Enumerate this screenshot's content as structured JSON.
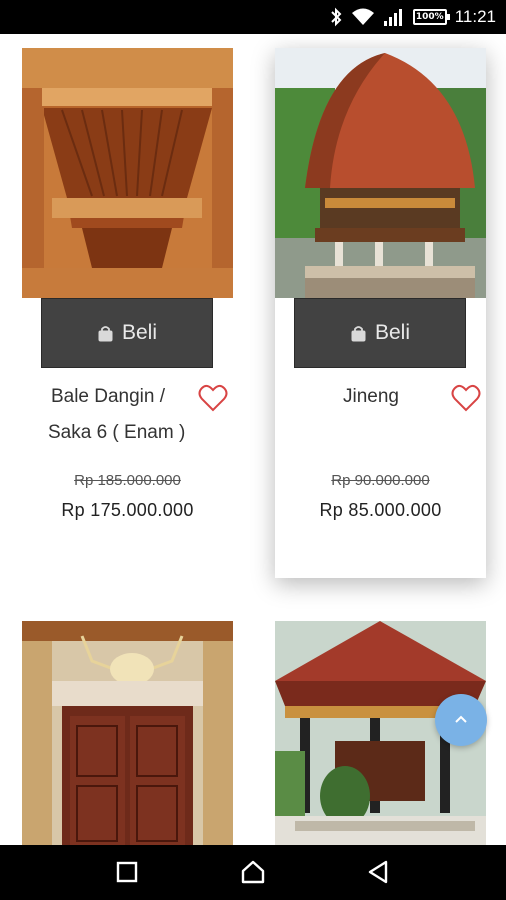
{
  "status_bar": {
    "battery": "100%",
    "time": "11:21",
    "icons": [
      "bluetooth-icon",
      "wifi-icon",
      "signal-icon",
      "battery-icon"
    ]
  },
  "products": [
    {
      "title_line1": "Bale Dangin /",
      "title_line2": "Saka 6 ( Enam )",
      "old_price": "Rp 185.000.000",
      "price": "Rp 175.000.000",
      "buy_label": "Beli"
    },
    {
      "title_line1": "Jineng",
      "title_line2": "",
      "old_price": "Rp 90.000.000",
      "price": "Rp 85.000.000",
      "buy_label": "Beli"
    }
  ],
  "colors": {
    "button": "#424242",
    "fab": "#7ab2e6",
    "heart": "#d32f2f"
  },
  "navigation": {
    "items": [
      "recent-apps-button",
      "home-button",
      "back-button"
    ]
  }
}
